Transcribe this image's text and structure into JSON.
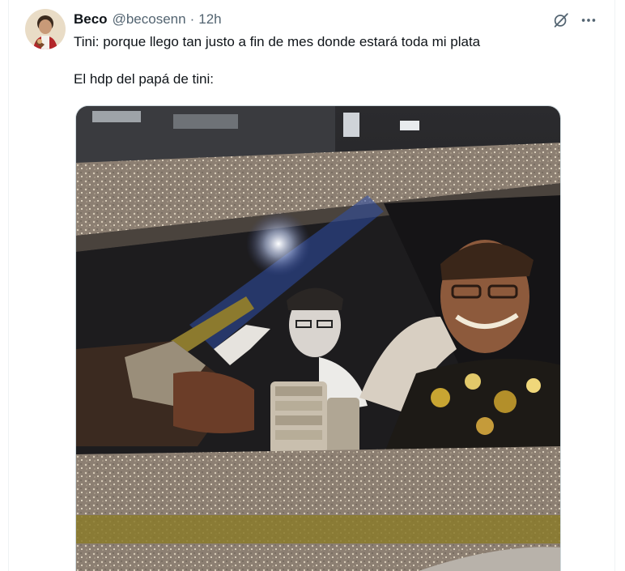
{
  "tweet": {
    "author": {
      "display_name": "Beco",
      "handle": "@becosenn",
      "separator": "·",
      "time": "12h"
    },
    "text_lines": [
      "Tini: porque llego tan justo a fin de mes donde estará toda mi plata",
      "El hdp del papá de tini:"
    ],
    "icons": {
      "grok": "grok-icon",
      "more": "more-icon"
    },
    "media": {
      "kind": "video-frame",
      "subject": "car-with-sparkly-glitter-body"
    }
  },
  "colors": {
    "text_primary": "#0f1419",
    "text_secondary": "#536471",
    "border": "#eff3f4"
  }
}
